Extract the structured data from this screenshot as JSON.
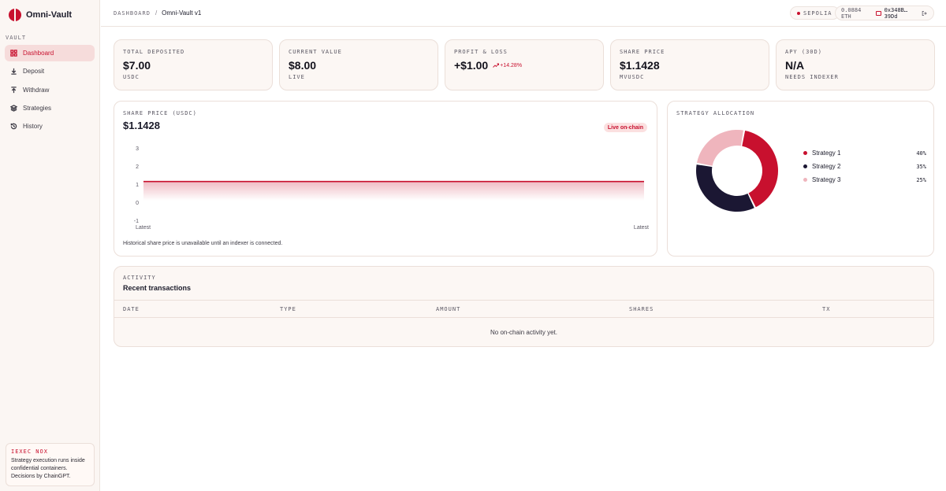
{
  "brand": {
    "name": "Omni-Vault"
  },
  "sidebar": {
    "section": "VAULT",
    "items": [
      {
        "label": "Dashboard",
        "icon": "grid-icon",
        "active": true
      },
      {
        "label": "Deposit",
        "icon": "arrow-down-icon"
      },
      {
        "label": "Withdraw",
        "icon": "arrow-up-icon"
      },
      {
        "label": "Strategies",
        "icon": "layers-icon"
      },
      {
        "label": "History",
        "icon": "history-icon"
      }
    ],
    "info": {
      "title": "IEXEC NOX",
      "text": "Strategy execution runs inside confidential containers. Decisions by ChainGPT."
    }
  },
  "topbar": {
    "breadcrumb_root": "DASHBOARD",
    "breadcrumb_sep": "/",
    "breadcrumb_current": "Omni-Vault v1",
    "network": "SEPOLIA",
    "balance": "0.0884 ETH",
    "address": "0x348B…39Dd"
  },
  "stats": [
    {
      "label": "TOTAL DEPOSITED",
      "value": "$7.00",
      "sub": "USDC"
    },
    {
      "label": "CURRENT VALUE",
      "value": "$8.00",
      "sub": "LIVE"
    },
    {
      "label": "PROFIT & LOSS",
      "value": "+$1.00",
      "delta": "+14.28%"
    },
    {
      "label": "SHARE PRICE",
      "value": "$1.1428",
      "sub": "MVUSDC"
    },
    {
      "label": "APY (30D)",
      "value": "N/A",
      "sub": "NEEDS INDEXER"
    }
  ],
  "share_price_card": {
    "label": "SHARE PRICE (USDC)",
    "value": "$1.1428",
    "badge": "Live on-chain",
    "note": "Historical share price is unavailable until an indexer is connected."
  },
  "chart_data": {
    "type": "area",
    "x": [
      "Latest",
      "Latest"
    ],
    "values": [
      1.1428,
      1.1428
    ],
    "ylim": [
      -1,
      3
    ],
    "yticks": [
      "3",
      "2",
      "1",
      "0",
      "-1"
    ],
    "color": "#c8102e"
  },
  "allocation": {
    "label": "STRATEGY ALLOCATION",
    "items": [
      {
        "name": "Strategy 1",
        "pct": "40%",
        "value": 40,
        "color": "#c8102e"
      },
      {
        "name": "Strategy 2",
        "pct": "35%",
        "value": 35,
        "color": "#1b1733"
      },
      {
        "name": "Strategy 3",
        "pct": "25%",
        "value": 25,
        "color": "#efb5bd"
      }
    ]
  },
  "activity": {
    "label": "ACTIVITY",
    "title": "Recent transactions",
    "columns": [
      "DATE",
      "TYPE",
      "AMOUNT",
      "SHARES",
      "TX"
    ],
    "empty": "No on-chain activity yet."
  }
}
